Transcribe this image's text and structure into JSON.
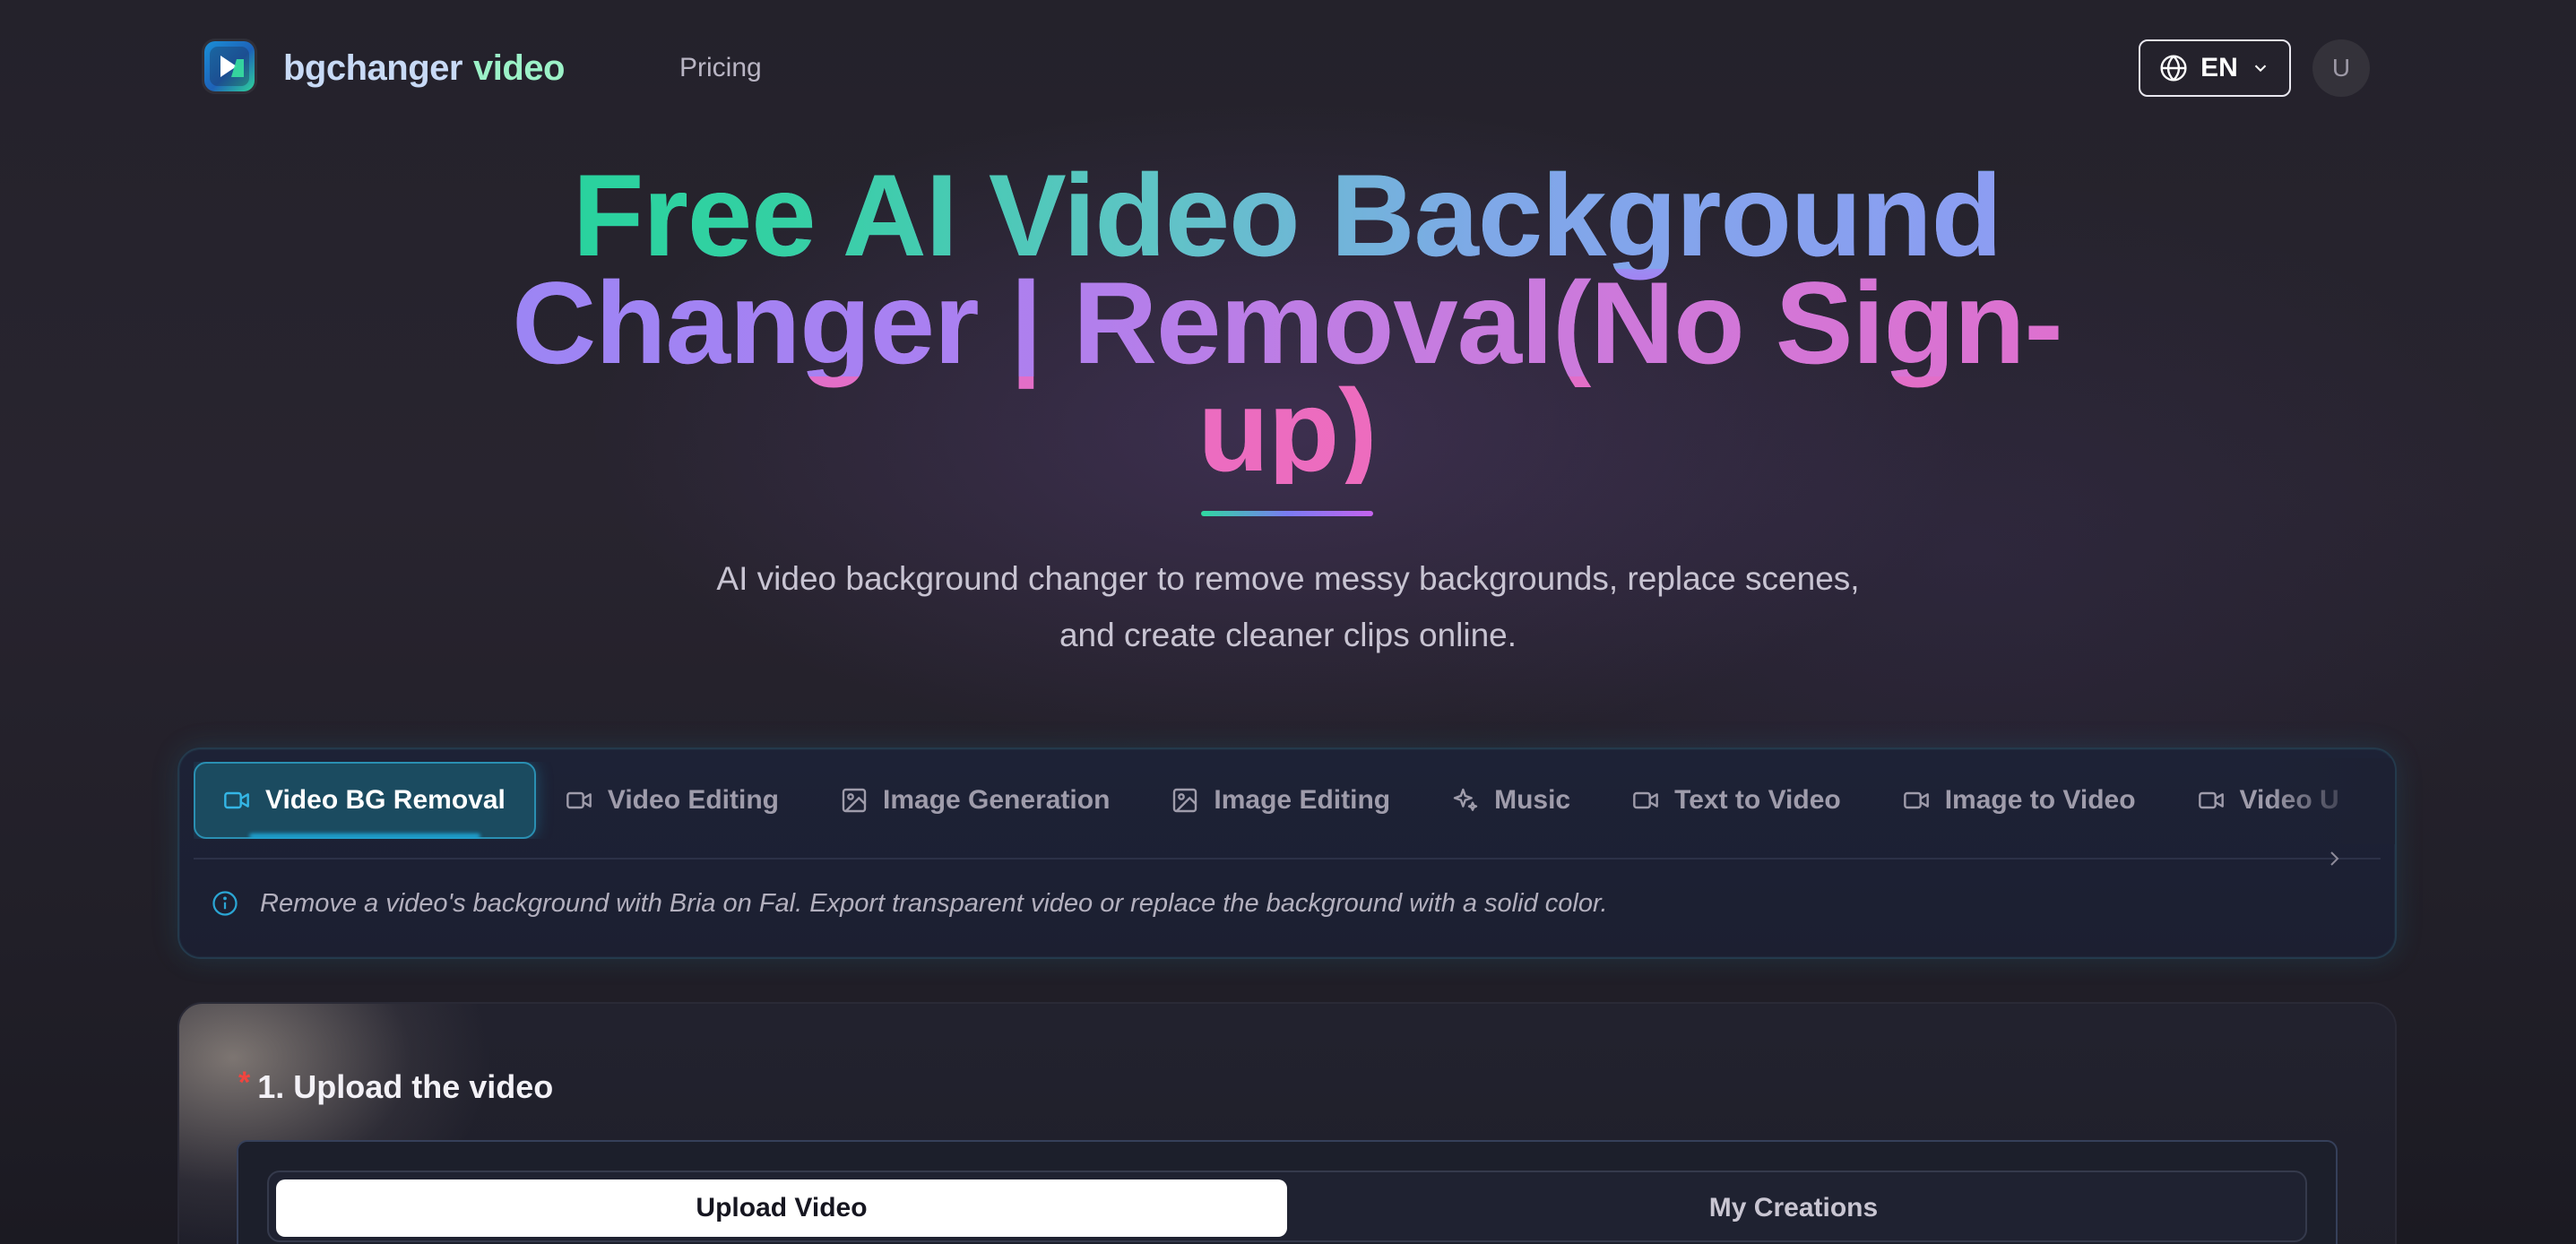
{
  "brand": {
    "name_part1": "bgchanger",
    "name_part2": "video"
  },
  "nav": {
    "pricing": "Pricing",
    "language": "EN",
    "avatar_initial": "U"
  },
  "hero": {
    "title_line1": "Free AI Video Background",
    "title_line2": "Changer | Removal(No Sign-",
    "title_line3": "up)",
    "subtitle_line1": "AI video background changer to remove messy backgrounds, replace scenes,",
    "subtitle_line2": "and create cleaner clips online."
  },
  "tools": {
    "tabs": [
      {
        "label": "Video BG Removal",
        "icon": "video-icon",
        "active": true
      },
      {
        "label": "Video Editing",
        "icon": "video-icon",
        "active": false
      },
      {
        "label": "Image Generation",
        "icon": "image-icon",
        "active": false
      },
      {
        "label": "Image Editing",
        "icon": "image-icon",
        "active": false
      },
      {
        "label": "Music",
        "icon": "sparkles-icon",
        "active": false
      },
      {
        "label": "Text to Video",
        "icon": "video-icon",
        "active": false
      },
      {
        "label": "Image to Video",
        "icon": "video-icon",
        "active": false
      },
      {
        "label": "Video U",
        "icon": "video-icon",
        "active": false
      }
    ],
    "info": "Remove a video's background with Bria on Fal. Export transparent video or replace the background with a solid color."
  },
  "upload": {
    "required_mark": "*",
    "step_title": "1. Upload the video",
    "segments": {
      "upload": "Upload Video",
      "creations": "My Creations"
    }
  },
  "colors": {
    "page_bg": "#221f29",
    "accent_cyan": "#2a8fb2",
    "title_green": "#22d49b",
    "title_purple": "#a47ff3",
    "title_pink": "#ee6bbf",
    "required_red": "#f0453f"
  }
}
